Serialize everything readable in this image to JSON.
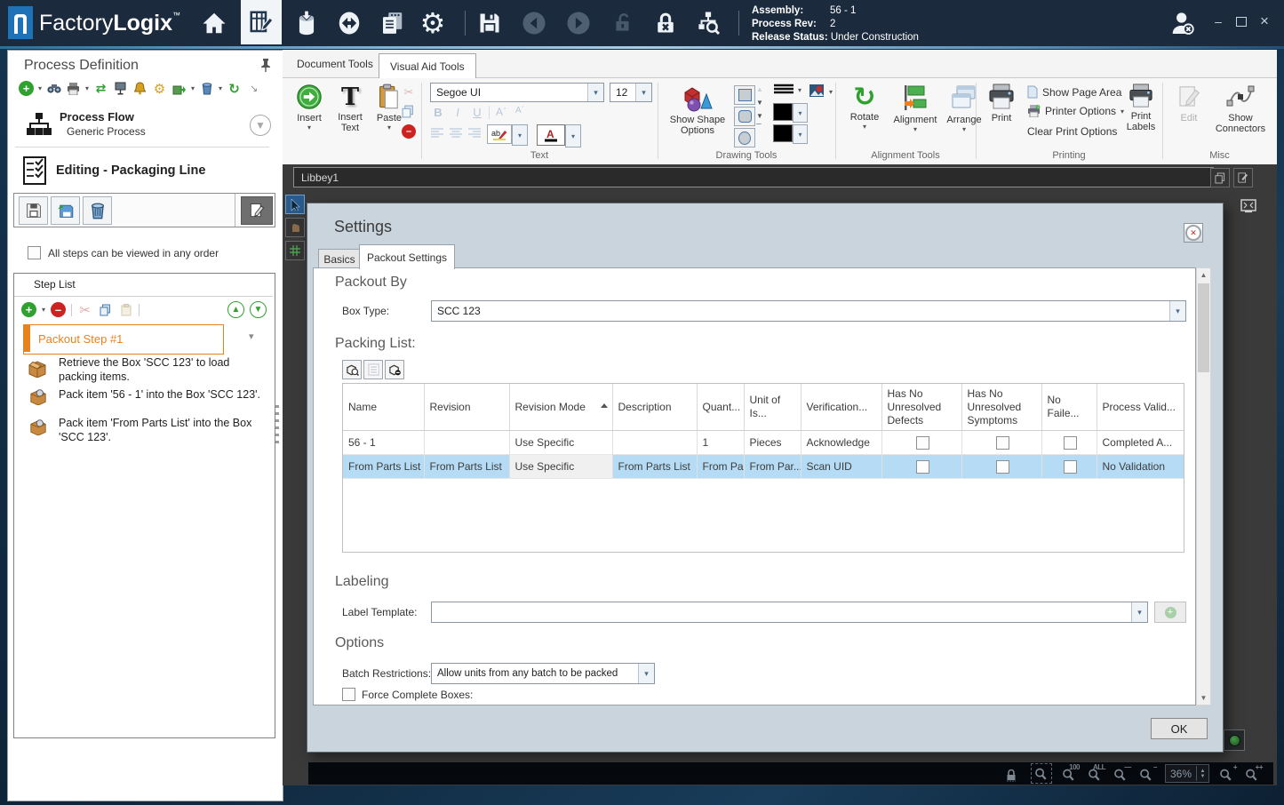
{
  "titlebar": {
    "app_name_primary": "Factory",
    "app_name_secondary": "Logix",
    "trademark": "™",
    "info": {
      "assembly_label": "Assembly:",
      "assembly_value": "56 - 1",
      "process_rev_label": "Process Rev:",
      "process_rev_value": "2",
      "release_status_label": "Release Status:",
      "release_status_value": "Under Construction"
    },
    "window_controls": {
      "minimize": "–",
      "close": "×"
    }
  },
  "left_panel": {
    "title": "Process Definition",
    "process_flow_title": "Process Flow",
    "process_flow_subtitle": "Generic Process",
    "editing_title": "Editing - Packaging Line",
    "any_order_label": "All steps can be viewed in any order",
    "step_list_title": "Step List",
    "active_step_label": "Packout Step #1",
    "steps": [
      "Retrieve the Box 'SCC 123' to load packing items.",
      "Pack item '56 - 1' into the Box 'SCC 123'.",
      "Pack item 'From Parts List' into the Box 'SCC 123'."
    ]
  },
  "ribbon": {
    "tabs": [
      "Document Tools",
      "Visual Aid Tools"
    ],
    "insert_label": "Insert",
    "insert_text_label": "Insert Text",
    "paste_label": "Paste",
    "text_group": {
      "label": "Text",
      "font_family": "Segoe UI",
      "font_size": "12",
      "bold": "B",
      "italic": "I",
      "underline": "U"
    },
    "drawing_group": {
      "label": "Drawing Tools",
      "show_shape_options_label": "Show Shape Options"
    },
    "alignment_group": {
      "label": "Alignment Tools",
      "rotate_label": "Rotate",
      "alignment_label": "Alignment",
      "arrange_label": "Arrange"
    },
    "printing_group": {
      "label": "Printing",
      "print_label": "Print",
      "show_page_area_label": "Show Page Area",
      "printer_options_label": "Printer Options",
      "clear_print_options_label": "Clear Print Options",
      "print_labels_label": "Print Labels"
    },
    "misc_group": {
      "label": "Misc",
      "edit_label": "Edit",
      "show_connectors_label": "Show Connectors"
    }
  },
  "canvas": {
    "document_name": "Libbey1"
  },
  "statusbar": {
    "zoom_100": "100",
    "zoom_all": "ALL",
    "zoom_value": "36%"
  },
  "dialog": {
    "title": "Settings",
    "tabs": [
      "Basics",
      "Packout Settings"
    ],
    "packout_by_heading": "Packout By",
    "box_type_label": "Box Type:",
    "box_type_value": "SCC 123",
    "packing_list_heading": "Packing List:",
    "table": {
      "columns": [
        "Name",
        "Revision",
        "Revision Mode",
        "Description",
        "Quant...",
        "Unit of Is...",
        "Verification...",
        "Has No Unresolved Defects",
        "Has No Unresolved Symptoms",
        "No Faile...",
        "Process Valid..."
      ],
      "rows": [
        {
          "name": "56 - 1",
          "revision": "",
          "revision_mode": "Use Specific",
          "description": "",
          "quantity": "1",
          "unit": "Pieces",
          "verification": "Acknowledge",
          "has_no_unresolved_defects": false,
          "has_no_unresolved_symptoms": false,
          "no_failed": false,
          "process_validation": "Completed A..."
        },
        {
          "name": "From Parts List",
          "revision": "From Parts List",
          "revision_mode": "Use Specific",
          "description": "From Parts List",
          "quantity": "From Pa",
          "unit": "From Par...",
          "verification": "Scan UID",
          "has_no_unresolved_defects": false,
          "has_no_unresolved_symptoms": false,
          "no_failed": false,
          "process_validation": "No Validation"
        }
      ]
    },
    "labeling_heading": "Labeling",
    "label_template_label": "Label Template:",
    "label_template_value": "",
    "options_heading": "Options",
    "batch_restrictions_label": "Batch Restrictions:",
    "batch_restrictions_value": "Allow units from any batch to be packed",
    "force_complete_label": "Force Complete Boxes:",
    "ok_label": "OK"
  },
  "colors": {
    "titlebar": "#1B2A3D",
    "logo_blue": "#1D72B8",
    "accent_orange": "#E8821E",
    "selected_row": "#B5DCF4",
    "doc_area": "#3A3A3A"
  }
}
